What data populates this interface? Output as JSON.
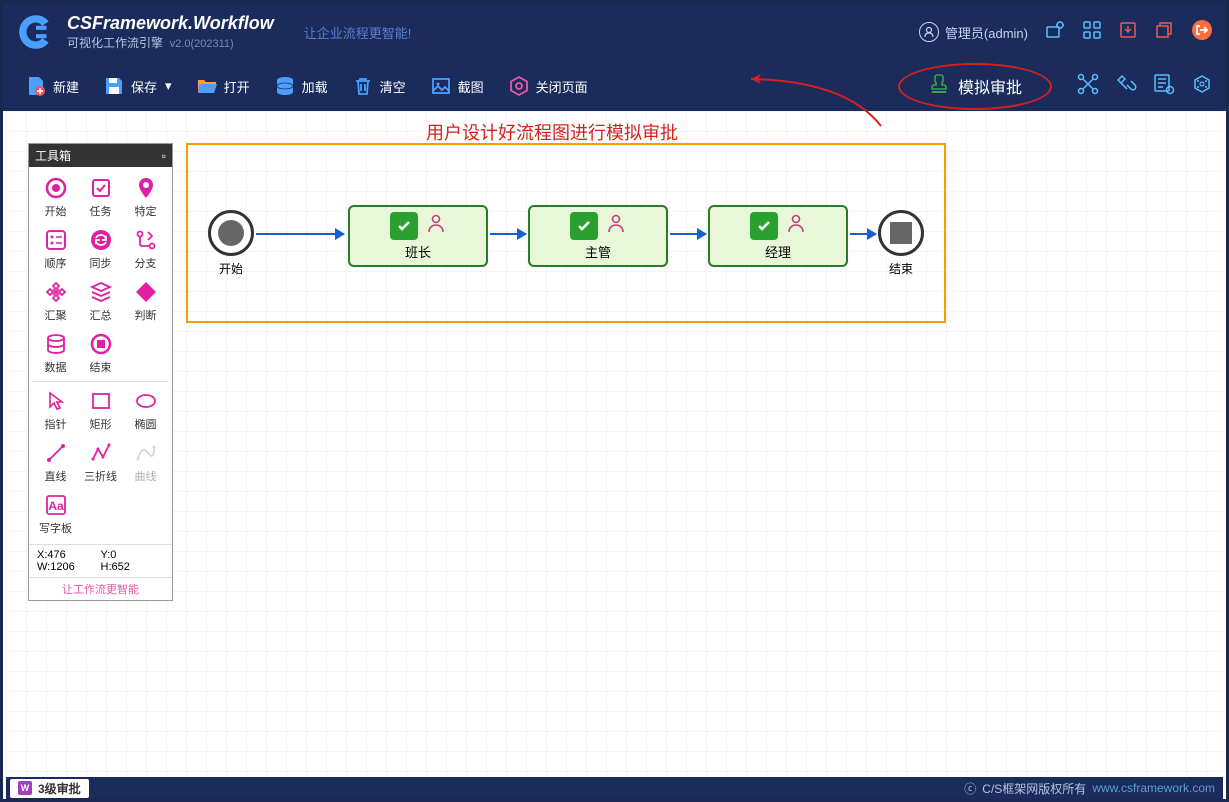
{
  "header": {
    "title": "CSFramework.Workflow",
    "subtitle": "可视化工作流引擎",
    "version": "v2.0(202311)",
    "slogan": "让企业流程更智能!",
    "user": "管理员(admin)"
  },
  "toolbar": {
    "new": "新建",
    "save": "保存",
    "open": "打开",
    "load": "加载",
    "clear": "清空",
    "snap": "截图",
    "close": "关闭页面",
    "simulate": "模拟审批"
  },
  "annotation": "用户设计好流程图进行模拟审批",
  "toolbox": {
    "title": "工具箱",
    "items1": [
      {
        "label": "开始"
      },
      {
        "label": "任务"
      },
      {
        "label": "特定"
      },
      {
        "label": "顺序"
      },
      {
        "label": "同步"
      },
      {
        "label": "分支"
      },
      {
        "label": "汇聚"
      },
      {
        "label": "汇总"
      },
      {
        "label": "判断"
      },
      {
        "label": "数据"
      },
      {
        "label": "结束"
      }
    ],
    "items2": [
      {
        "label": "指针"
      },
      {
        "label": "矩形"
      },
      {
        "label": "椭圆"
      },
      {
        "label": "直线"
      },
      {
        "label": "三折线"
      },
      {
        "label": "曲线"
      },
      {
        "label": "写字板"
      }
    ],
    "coords": {
      "x": "X:476",
      "y": "Y:0",
      "w": "W:1206",
      "h": "H:652"
    },
    "footer": "让工作流更智能"
  },
  "flow": {
    "start": "开始",
    "end": "结束",
    "tasks": [
      "班长",
      "主管",
      "经理"
    ]
  },
  "status": {
    "tab": "3级审批",
    "copyright": "C/S框架网版权所有",
    "url": "www.csframework.com"
  }
}
